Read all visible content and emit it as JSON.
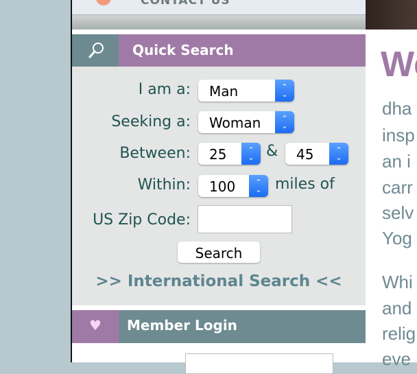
{
  "nav": {
    "contact_label": "CONTACT US"
  },
  "quick_search": {
    "title": "Quick Search",
    "i_am_label": "I am a:",
    "i_am_value": "Man",
    "seeking_label": "Seeking a:",
    "seeking_value": "Woman",
    "between_label": "Between:",
    "age_min": "25",
    "and_label": "&",
    "age_max": "45",
    "within_label": "Within:",
    "within_value": "100",
    "miles_label": "miles of",
    "zip_label": "US Zip Code:",
    "zip_value": "",
    "search_button": "Search",
    "international_link": ">> International Search <<"
  },
  "member_login": {
    "title": "Member Login"
  },
  "content": {
    "heading": "We",
    "lines": [
      "dha",
      "insp",
      "an i",
      "carr",
      "selv",
      "Yog",
      "Whi",
      "and",
      "relig",
      "eve"
    ]
  },
  "colors": {
    "purple": "#a07aa6",
    "teal": "#6e8b91",
    "label": "#1f5350",
    "link": "#5e8590"
  }
}
